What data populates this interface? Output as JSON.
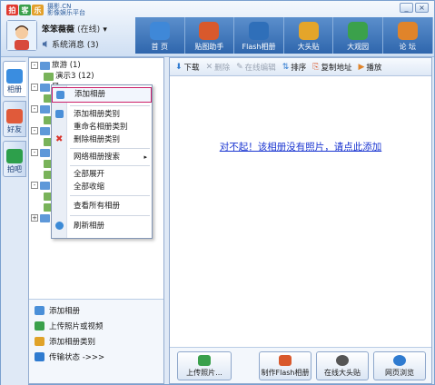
{
  "app": {
    "logo_chars": [
      "拍",
      "客",
      "乐"
    ],
    "logo_sub": [
      "摄影.CN",
      "影像娱乐平台"
    ],
    "window_buttons": [
      "_",
      "×"
    ]
  },
  "user": {
    "name": "笨笨薇薇",
    "status": "(在线)",
    "dropdown": "▾",
    "messages": "系统消息 (3)"
  },
  "nav": [
    {
      "label": "首 页",
      "color": "#3f88d8"
    },
    {
      "label": "贴图助手",
      "color": "#d9592c"
    },
    {
      "label": "Flash相册",
      "color": "#2f6fb9"
    },
    {
      "label": "大头贴",
      "color": "#e4a52a"
    },
    {
      "label": "大观园",
      "color": "#3ba14b"
    },
    {
      "label": "论 坛",
      "color": "#e0842a"
    }
  ],
  "vtabs": [
    {
      "label": "相册",
      "color": "#3a8de0"
    },
    {
      "label": "好友",
      "color": "#e05a3a"
    },
    {
      "label": "拍吧",
      "color": "#2d9f4b"
    }
  ],
  "tree": [
    {
      "toggle": "-",
      "indent": 0,
      "label": "旅游 (1)"
    },
    {
      "toggle": "",
      "indent": 14,
      "label": "演示3 (12)"
    },
    {
      "toggle": "-",
      "indent": 0,
      "label": "风"
    },
    {
      "toggle": "",
      "indent": 14,
      "label": ""
    },
    {
      "toggle": "-",
      "indent": 0,
      "label": "人"
    },
    {
      "toggle": "",
      "indent": 14,
      "label": ""
    },
    {
      "toggle": "-",
      "indent": 0,
      "label": "朋"
    },
    {
      "toggle": "",
      "indent": 14,
      "label": ""
    },
    {
      "toggle": "-",
      "indent": 0,
      "label": "旅"
    },
    {
      "toggle": "",
      "indent": 14,
      "label": ""
    },
    {
      "toggle": "",
      "indent": 14,
      "label": ""
    },
    {
      "toggle": "-",
      "indent": 0,
      "label": "风"
    },
    {
      "toggle": "",
      "indent": 14,
      "label": ""
    },
    {
      "toggle": "",
      "indent": 14,
      "label": ""
    },
    {
      "toggle": "+",
      "indent": 0,
      "label": "人"
    }
  ],
  "context_menu": {
    "items": [
      {
        "label": "添加相册",
        "highlighted": true,
        "color": "#4a8fd8"
      },
      {
        "label": "添加相册类别",
        "color": "#4a8fd8"
      },
      {
        "label": "重命名相册类别",
        "color": ""
      },
      {
        "label": "删除相册类别",
        "color": "#d9342b",
        "icon": "x-icon"
      },
      {
        "label": "网络相册搜索",
        "color": "",
        "submenu": "▸"
      },
      {
        "label": "全部展开",
        "color": ""
      },
      {
        "label": "全部收缩",
        "color": ""
      },
      {
        "label": "查看所有相册",
        "color": ""
      },
      {
        "label": "刷新相册",
        "color": "#3c8ad6"
      }
    ]
  },
  "left_bottom": [
    {
      "label": "添加相册",
      "color": "#4a8fd8"
    },
    {
      "label": "上传照片或视频",
      "color": "#3aa04b"
    },
    {
      "label": "添加相册类别",
      "color": "#e0a32a"
    },
    {
      "label": "传输状态 ->>>",
      "color": "#2f7bd0"
    }
  ],
  "toolbar": [
    {
      "icon": "⬇",
      "label": "下载",
      "disabled": false,
      "color": "#2f7bd0"
    },
    {
      "icon": "✕",
      "label": "删除",
      "disabled": true,
      "color": "#b8b8b8"
    },
    {
      "icon": "✎",
      "label": "在线编辑",
      "disabled": true,
      "color": "#b8b8b8"
    },
    {
      "icon": "⇅",
      "label": "排序",
      "disabled": false,
      "color": "#2f7bd0"
    },
    {
      "icon": "⎘",
      "label": "复制地址",
      "disabled": false,
      "color": "#d9592c"
    },
    {
      "icon": "▶",
      "label": "播放",
      "disabled": false,
      "color": "#e0842a"
    }
  ],
  "notice": "对不起！该相册没有照片，请点此添加",
  "bottom_buttons": [
    {
      "label": "上传照片...",
      "color": "#3aa04b"
    },
    {
      "label": "制作Flash相册",
      "color": "#d9592c"
    },
    {
      "label": "在线大头贴",
      "color": "#555555"
    },
    {
      "label": "网页浏览",
      "color": "#2f7bd0"
    }
  ]
}
